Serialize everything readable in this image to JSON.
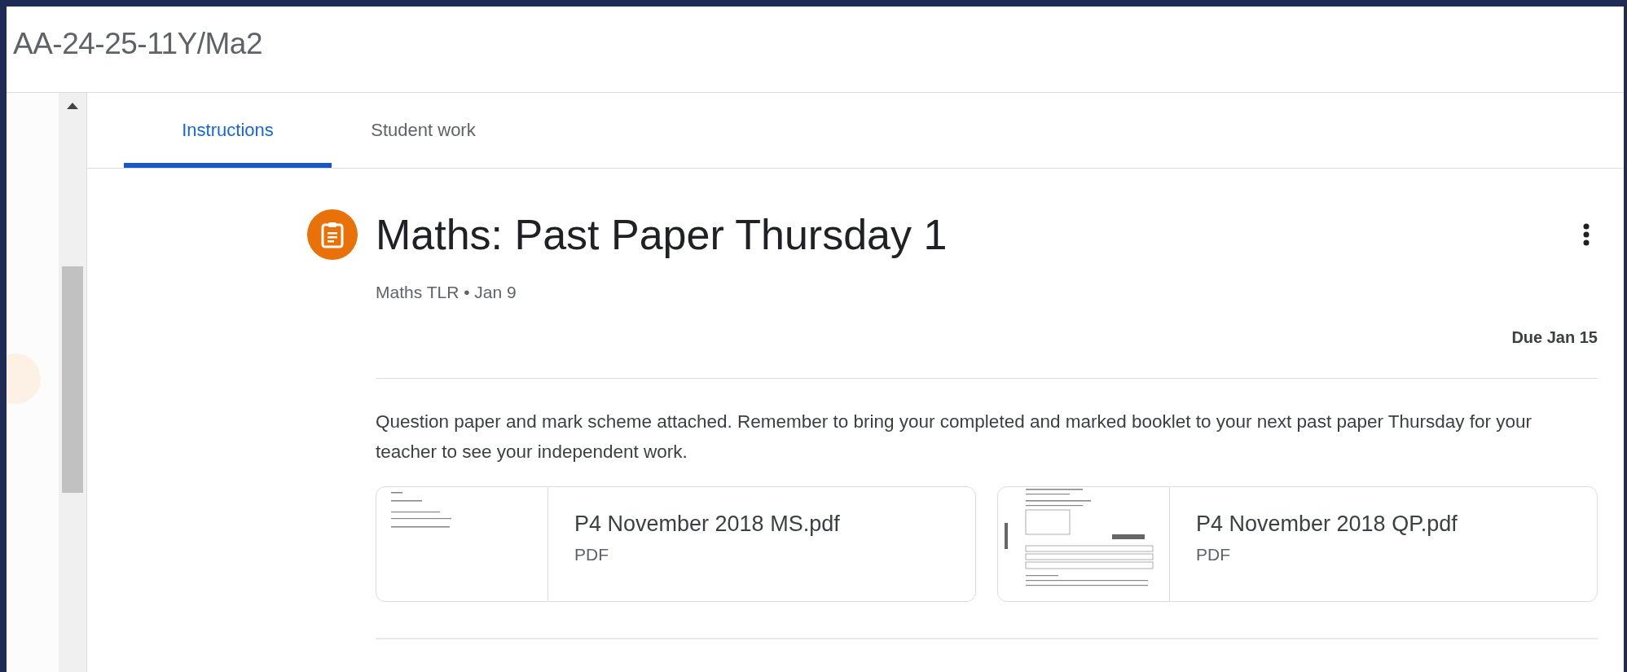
{
  "header": {
    "title": "AA-24-25-11Y/Ma2"
  },
  "tabs": [
    {
      "label": "Instructions",
      "selected": true
    },
    {
      "label": "Student work",
      "selected": false
    }
  ],
  "assignment": {
    "title": "Maths: Past Paper Thursday 1",
    "meta": "Maths TLR • Jan 9",
    "due": "Due Jan 15",
    "description": "Question paper and mark scheme attached. Remember to bring your completed and marked booklet to your next past paper Thursday for your teacher to see your independent work."
  },
  "attachments": [
    {
      "name": "P4 November 2018 MS.pdf",
      "type": "PDF",
      "kind": "mark-scheme"
    },
    {
      "name": "P4 November 2018 QP.pdf",
      "type": "PDF",
      "kind": "question-paper"
    }
  ]
}
